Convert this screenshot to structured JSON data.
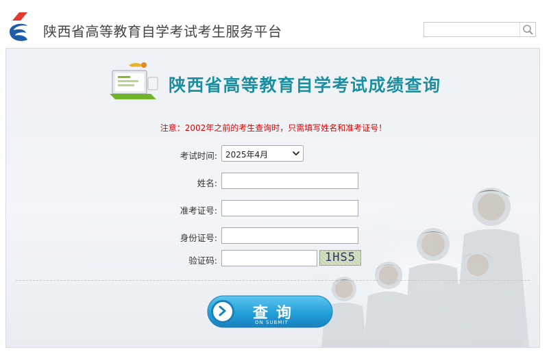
{
  "header": {
    "site_title": "陕西省高等教育自学考试考生服务平台",
    "search_placeholder": ""
  },
  "banner": {
    "title": "陕西省高等教育自学考试成绩查询"
  },
  "notice": "注意：2002年之前的考生查询时，只需填写姓名和准考证号！",
  "form": {
    "exam_time_label": "考试时间:",
    "exam_time_value": "2025年4月",
    "name_label": "姓名:",
    "name_value": "",
    "admission_label": "准考证号:",
    "admission_value": "",
    "id_label": "身份证号:",
    "id_value": "",
    "captcha_label": "验证码:",
    "captcha_value": "",
    "captcha_text": "1HS5"
  },
  "submit": {
    "label": "查询",
    "sub_label": "ON SUBMIT"
  },
  "colors": {
    "notice": "#e00000",
    "banner_title": "#1a8fa0",
    "button": "#2aa3dc"
  }
}
